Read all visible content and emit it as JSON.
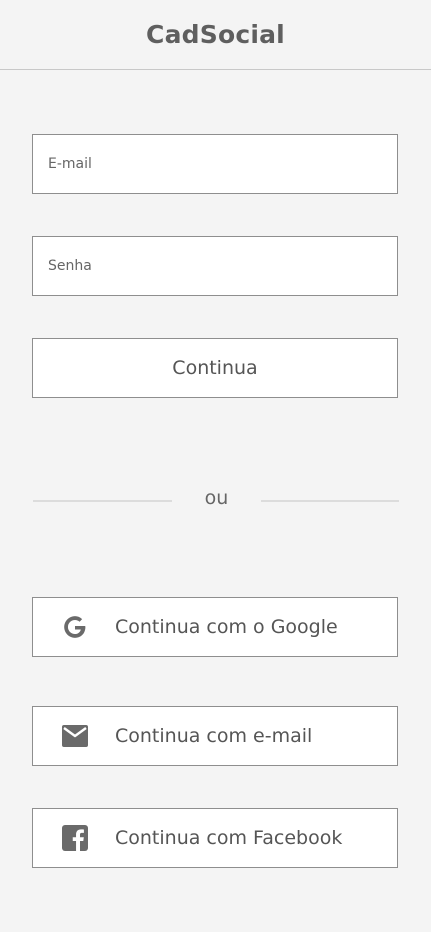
{
  "header": {
    "title": "CadSocial"
  },
  "form": {
    "email_placeholder": "E-mail",
    "password_placeholder": "Senha",
    "continue_label": "Continua"
  },
  "divider": {
    "text": "ou"
  },
  "social": {
    "google_label": "Continua com o Google",
    "google_icon": "google-icon",
    "email_label": "Continua com e-mail",
    "email_icon": "mail-icon",
    "facebook_label": "Continua com Facebook",
    "facebook_icon": "facebook-icon"
  },
  "colors": {
    "background": "#f4f4f4",
    "border": "#8e8e8e",
    "text": "#555555",
    "icon": "#6a6a6a"
  }
}
